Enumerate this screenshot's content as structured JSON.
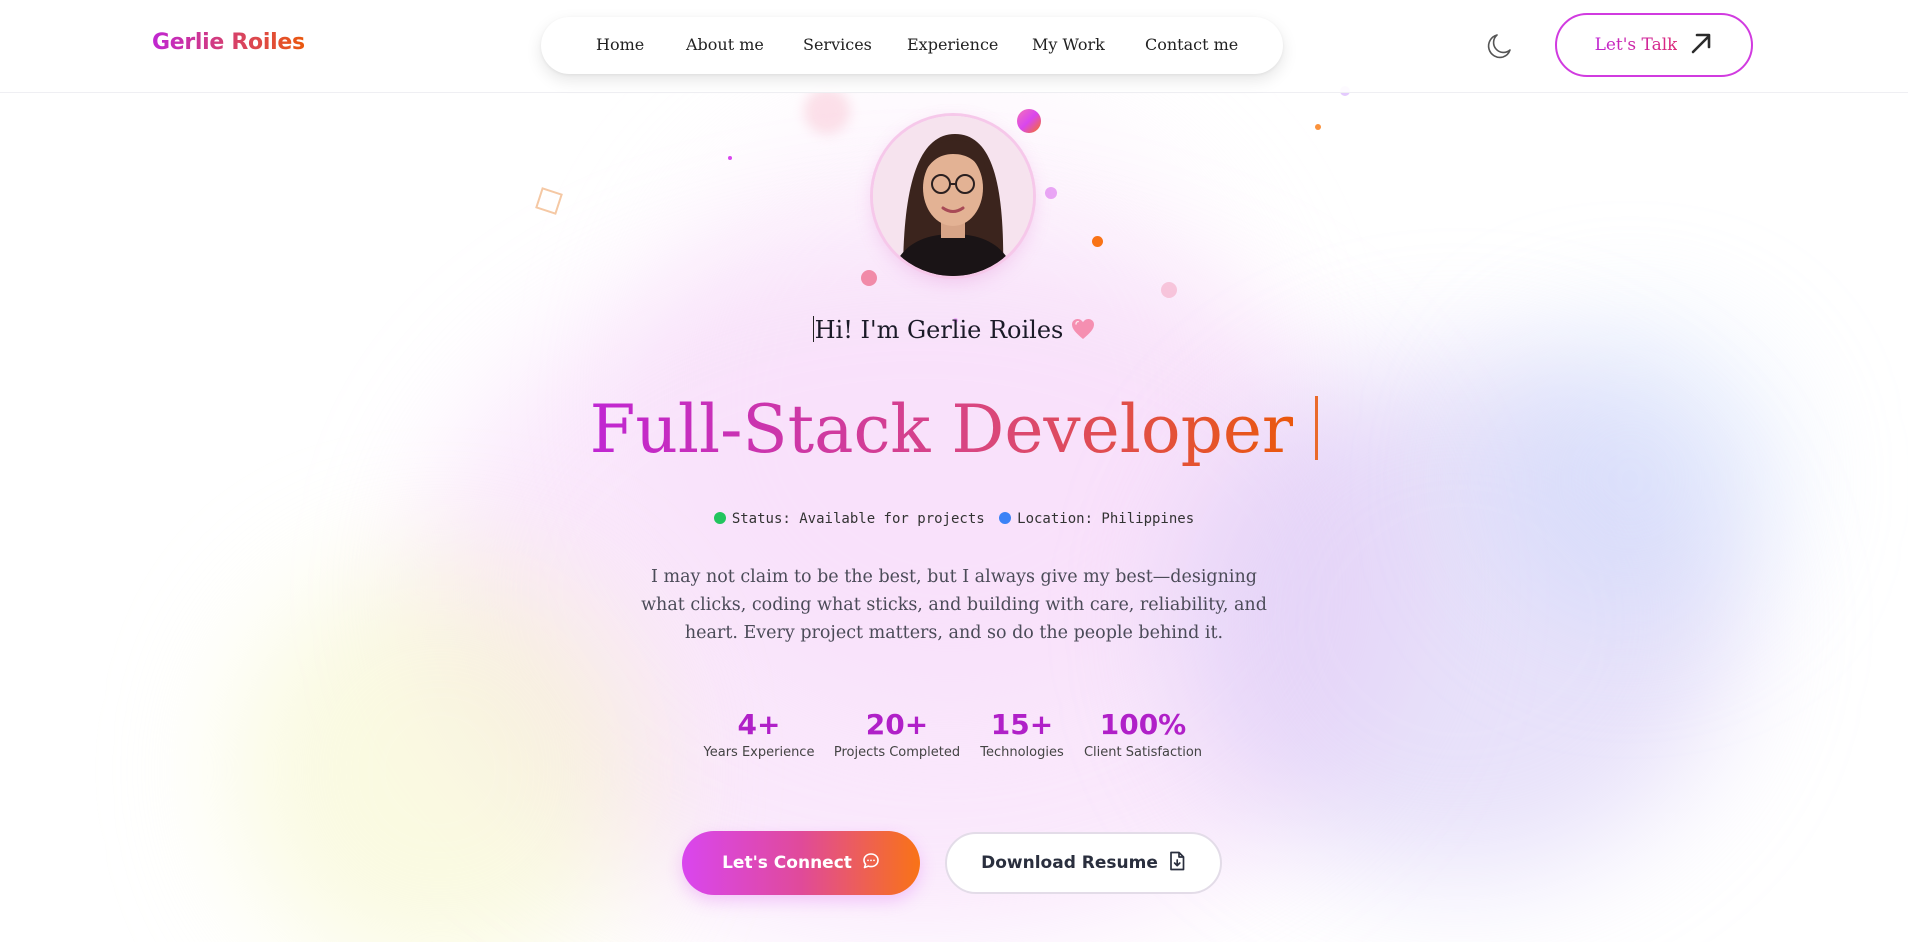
{
  "brand": {
    "name": "Gerlie Roiles"
  },
  "nav": {
    "items": [
      {
        "label": "Home"
      },
      {
        "label": "About me"
      },
      {
        "label": "Services"
      },
      {
        "label": "Experience"
      },
      {
        "label": "My Work"
      },
      {
        "label": "Contact me"
      }
    ]
  },
  "header": {
    "theme_toggle_icon": "moon-icon",
    "cta_label": "Let's Talk",
    "cta_icon": "arrow-up-right-icon"
  },
  "hero": {
    "greeting": "Hi! I'm Gerlie Roiles",
    "greeting_emoji": "heart-icon",
    "role": "Full-Stack Developer",
    "status": {
      "availability": "Status: Available for projects",
      "location": "Location: Philippines",
      "availability_color": "#22c55e",
      "location_color": "#3b82f6"
    },
    "bio": "I may not claim to be the best, but I always give my best—designing what clicks, coding what sticks, and building with care, reliability, and heart. Every project matters, and so do the people behind it."
  },
  "stats": [
    {
      "value": "4+",
      "label": "Years Experience"
    },
    {
      "value": "20+",
      "label": "Projects Completed"
    },
    {
      "value": "15+",
      "label": "Technologies"
    },
    {
      "value": "100%",
      "label": "Client Satisfaction"
    }
  ],
  "actions": {
    "connect_label": "Let's Connect",
    "connect_icon": "chat-bubble-icon",
    "resume_label": "Download Resume",
    "resume_icon": "document-download-icon"
  },
  "colors": {
    "accent_start": "#c026d3",
    "accent_end": "#ea580c"
  }
}
